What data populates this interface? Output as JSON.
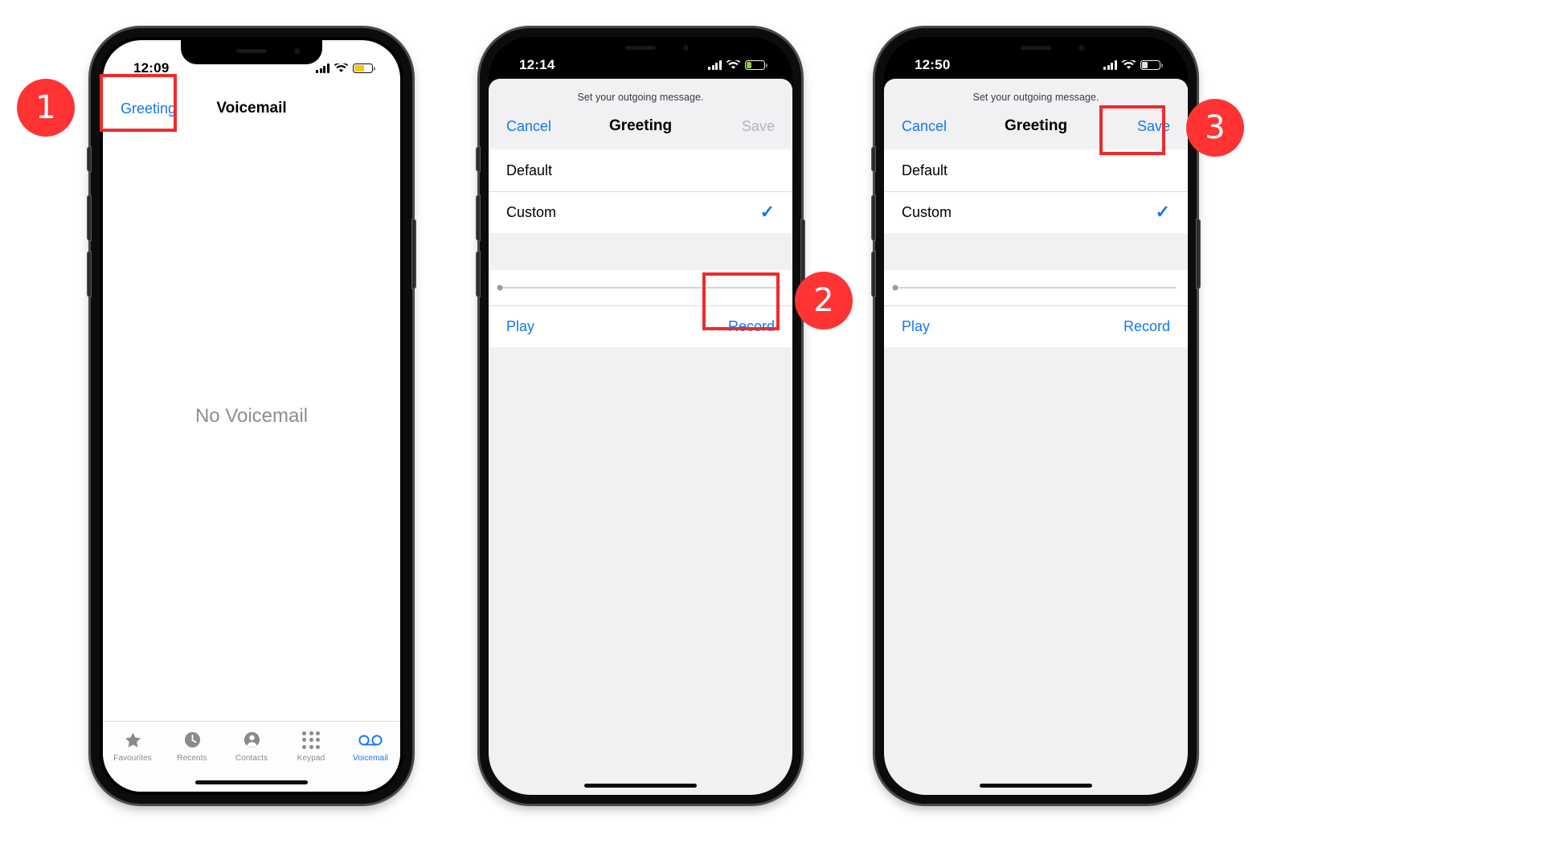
{
  "meta": {
    "title": "iPhone Voicemail greeting setup — 3 step tutorial"
  },
  "phones": [
    {
      "id": "phone-1",
      "status": {
        "time": "12:09",
        "battery_color": "#f2c20b",
        "battery_level": 52,
        "theme": "dark-icons"
      },
      "nav": {
        "left_action": "Greeting",
        "title": "Voicemail"
      },
      "empty_state": "No Voicemail",
      "tabs": [
        {
          "key": "favourites",
          "label": "Favourites",
          "icon": "star-icon",
          "active": false
        },
        {
          "key": "recents",
          "label": "Recents",
          "icon": "clock-icon",
          "active": false
        },
        {
          "key": "contacts",
          "label": "Contacts",
          "icon": "person-icon",
          "active": false
        },
        {
          "key": "keypad",
          "label": "Keypad",
          "icon": "keypad-icon",
          "active": false
        },
        {
          "key": "voicemail",
          "label": "Voicemail",
          "icon": "voicemail-icon",
          "active": true
        }
      ]
    },
    {
      "id": "phone-2",
      "status": {
        "time": "12:14",
        "battery_color": "#9ad043",
        "battery_level": 26,
        "theme": "light-icons"
      },
      "sheet": {
        "caption": "Set your outgoing message.",
        "cancel_label": "Cancel",
        "title": "Greeting",
        "save_label": "Save",
        "save_enabled": false,
        "options": [
          {
            "label": "Default",
            "selected": false
          },
          {
            "label": "Custom",
            "selected": true
          }
        ],
        "scrubber_position": 0,
        "play_label": "Play",
        "record_label": "Record"
      }
    },
    {
      "id": "phone-3",
      "status": {
        "time": "12:50",
        "battery_color": "#ededed",
        "battery_level": 30,
        "theme": "light-icons"
      },
      "sheet": {
        "caption": "Set your outgoing message.",
        "cancel_label": "Cancel",
        "title": "Greeting",
        "save_label": "Save",
        "save_enabled": true,
        "options": [
          {
            "label": "Default",
            "selected": false
          },
          {
            "label": "Custom",
            "selected": true
          }
        ],
        "scrubber_position": 0,
        "play_label": "Play",
        "record_label": "Record"
      }
    }
  ],
  "annotations": {
    "accent_color": "#ee2b2b",
    "badge_color": "#f33",
    "steps": [
      {
        "number": "1",
        "targets": "Greeting button on Voicemail screen"
      },
      {
        "number": "2",
        "targets": "Record button in Greeting sheet"
      },
      {
        "number": "3",
        "targets": "Save button in Greeting sheet"
      }
    ]
  },
  "icons": {
    "check": "✓"
  }
}
